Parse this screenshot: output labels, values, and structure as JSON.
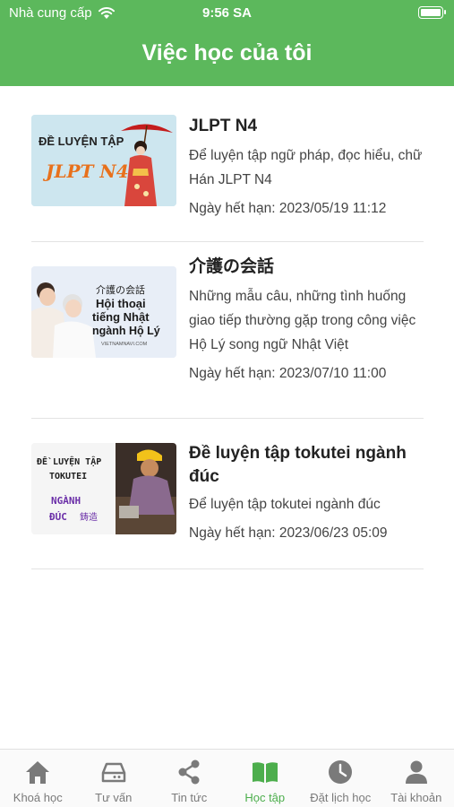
{
  "status_bar": {
    "carrier": "Nhà cung cấp",
    "time": "9:56 SA",
    "icons": [
      "wifi-icon",
      "battery-icon"
    ]
  },
  "header": {
    "title": "Việc học của tôi",
    "bg_color": "#5cb85c"
  },
  "courses": [
    {
      "name": "JLPT N4",
      "description": "Để luyện tập ngữ pháp, đọc hiểu, chữ Hán JLPT N4",
      "expiry": "Ngày hết hạn: 2023/05/19 11:12",
      "thumb": {
        "line1": "ĐỀ LUYỆN TẬP",
        "line2": "JLPT N4"
      }
    },
    {
      "name": "介護の会話",
      "description": "Những mẫu câu, những tình huống giao tiếp thường gặp trong công việc Hộ Lý song ngữ Nhật Việt",
      "expiry": "Ngày hết hạn: 2023/07/10 11:00",
      "thumb": {
        "line1": "介護の会話",
        "line2": "Hội thoại",
        "line3": "tiếng Nhật",
        "line4": "ngành Hộ Lý",
        "line5": "VIETNAMNAVI.COM"
      }
    },
    {
      "name": "Đề luyện tập tokutei ngành đúc",
      "description": "Để luyện tập tokutei ngành đúc",
      "expiry": "Ngày hết hạn: 2023/06/23 05:09",
      "thumb": {
        "line1": "ĐỀ LUYỆN TẬP",
        "line2": "TOKUTEI",
        "line3": "NGÀNH",
        "line4": "ĐÚC",
        "line5": "鋳造"
      }
    }
  ],
  "tabs": [
    {
      "label": "Khoá học",
      "icon": "home-icon",
      "active": false
    },
    {
      "label": "Tư vấn",
      "icon": "inbox-icon",
      "active": false
    },
    {
      "label": "Tin tức",
      "icon": "share-icon",
      "active": false
    },
    {
      "label": "Học tập",
      "icon": "book-icon",
      "active": true
    },
    {
      "label": "Đặt lịch học",
      "icon": "clock-icon",
      "active": false
    },
    {
      "label": "Tài khoản",
      "icon": "user-icon",
      "active": false
    }
  ],
  "colors": {
    "accent": "#5cb85c",
    "tab_active": "#4cae4c",
    "tab_inactive": "#7a7a7a",
    "thumb_n4_text": "#e8711c",
    "thumb_tokutei_text": "#6b2fa8"
  }
}
